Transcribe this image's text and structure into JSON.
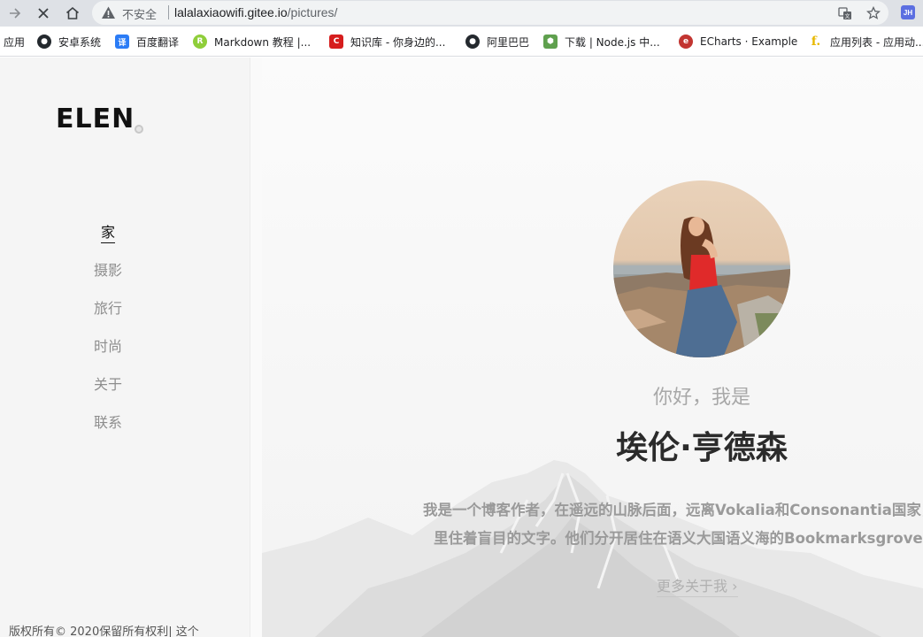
{
  "browser": {
    "insecure_label": "不安全",
    "url_host": "lalalaxiaowifi.gitee.io",
    "url_path": "/pictures/",
    "profile_initials": "JH"
  },
  "bookmarks": [
    {
      "label": "应用",
      "icon": "none"
    },
    {
      "label": "安卓系统",
      "icon": "github-icon"
    },
    {
      "label": "百度翻译",
      "icon": "baidu-translate-icon"
    },
    {
      "label": "Markdown 教程 |...",
      "icon": "runoob-icon"
    },
    {
      "label": "知识库 - 你身边的...",
      "icon": "csdn-icon"
    },
    {
      "label": "阿里巴巴",
      "icon": "github-icon"
    },
    {
      "label": "下载 | Node.js 中...",
      "icon": "nodejs-icon"
    },
    {
      "label": "ECharts · Example",
      "icon": "echarts-icon"
    },
    {
      "label": "应用列表 - 应用动...",
      "icon": "f-icon"
    }
  ],
  "sidebar": {
    "logo": "ELEN",
    "nav": [
      {
        "label": "家",
        "active": true
      },
      {
        "label": "摄影",
        "active": false
      },
      {
        "label": "旅行",
        "active": false
      },
      {
        "label": "时尚",
        "active": false
      },
      {
        "label": "关于",
        "active": false
      },
      {
        "label": "联系",
        "active": false
      }
    ],
    "copyright": "版权所有© 2020保留所有权利| 这个"
  },
  "hero": {
    "greeting": "你好，我是",
    "name": "埃伦·亨德森",
    "bio_line1": "我是一个博客作者，在遥远的山脉后面，远离Vokalia和Consonantia国家，那",
    "bio_line2": "里住着盲目的文字。他们分开居住在语义大国语义海的Bookmarksgrove海岸",
    "more_link": "更多关于我 ›"
  },
  "colors": {
    "chrome_bar": "#dee1e6",
    "sidebar_bg": "#f5f5f5",
    "name_text": "#2b2b2b",
    "muted_text": "#9a9a9a"
  }
}
